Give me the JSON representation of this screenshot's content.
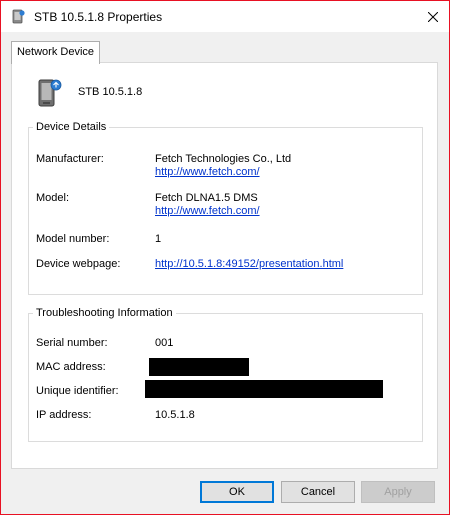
{
  "window": {
    "title": "STB 10.5.1.8 Properties",
    "accent_color": "#e81123"
  },
  "tabs": [
    {
      "label": "Network Device",
      "active": true
    }
  ],
  "device": {
    "name": "STB 10.5.1.8",
    "icon": "network-media-device-icon"
  },
  "device_details": {
    "title": "Device Details",
    "manufacturer_label": "Manufacturer:",
    "manufacturer_value": "Fetch Technologies Co., Ltd",
    "manufacturer_link": "http://www.fetch.com/",
    "model_label": "Model:",
    "model_value": "Fetch DLNA1.5 DMS",
    "model_link": "http://www.fetch.com/",
    "model_number_label": "Model number:",
    "model_number_value": "1",
    "webpage_label": "Device webpage:",
    "webpage_link": "http://10.5.1.8:49152/presentation.html"
  },
  "troubleshooting": {
    "title": "Troubleshooting Information",
    "serial_label": "Serial number:",
    "serial_value": "001",
    "mac_label": "MAC address:",
    "uid_label": "Unique identifier:",
    "ip_label": "IP address:",
    "ip_value": "10.5.1.8"
  },
  "buttons": {
    "ok": "OK",
    "cancel": "Cancel",
    "apply": "Apply"
  }
}
